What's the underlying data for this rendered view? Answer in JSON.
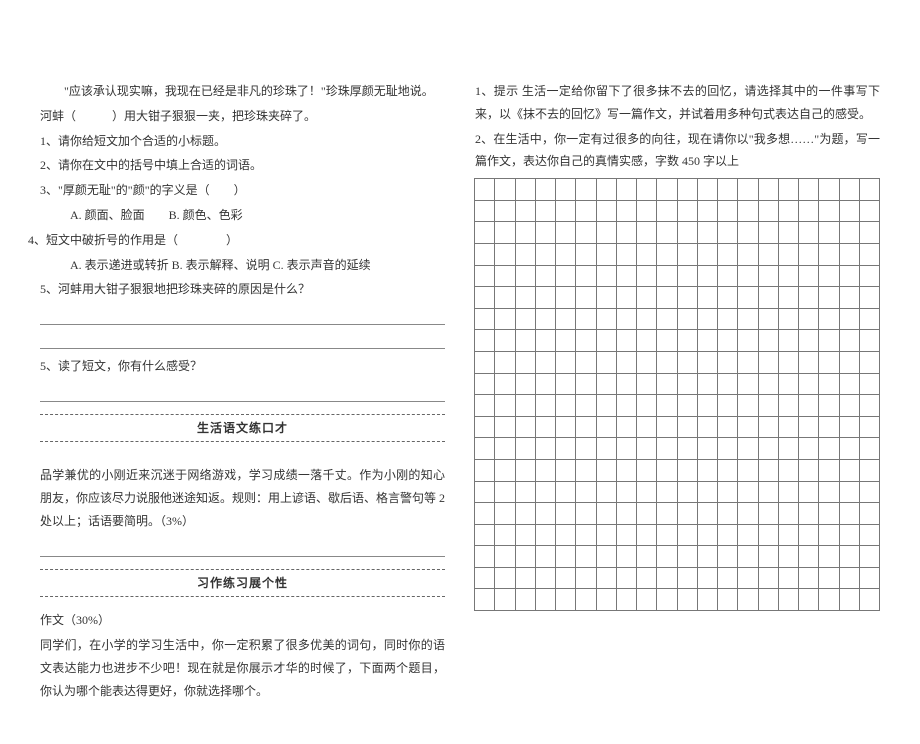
{
  "left": {
    "l1": "\"应该承认现实嘛，我现在已经是非凡的珍珠了！\"珍珠厚颜无耻地说。",
    "l2": "河蚌（　　　）用大钳子狠狠一夹，把珍珠夹碎了。",
    "q1": "1、请你给短文加个合适的小标题。",
    "q2": "2、请你在文中的括号中填上合适的词语。",
    "q3": "3、\"厚颜无耻\"的\"颜\"的字义是（　　）",
    "q3opts": "A. 颜面、脸面　　B. 颜色、色彩",
    "q4": "4、短文中破折号的作用是（　　　　）",
    "q4opts": "A. 表示递进或转折  B. 表示解释、说明  C. 表示声音的延续",
    "q5": "5、河蚌用大钳子狠狠地把珍珠夹碎的原因是什么？",
    "q6": "5、读了短文，你有什么感受？",
    "sec1": "生活语文练口才",
    "p1": "品学兼优的小刚近来沉迷于网络游戏，学习成绩一落千丈。作为小刚的知心朋友，你应该尽力说服他迷途知返。规则：用上谚语、歇后语、格言警句等 2 处以上；话语要简明。（3%）",
    "sec2": "习作练习展个性",
    "zw": "作文（30%）",
    "p2": "同学们，在小学的学习生活中，你一定积累了很多优美的词句，同时你的语文表达能力也进步不少吧！现在就是你展示才华的时候了，下面两个题目，你认为哪个能表达得更好，你就选择哪个。"
  },
  "right": {
    "r1": "1、提示  生活一定给你留下了很多抹不去的回忆，请选择其中的一件事写下来，以《抹不去的回忆》写一篇作文，并试着用多种句式表达自己的感受。",
    "r2": "2、在生活中，你一定有过很多的向往，现在请你以\"我多想……\"为题，写一篇作文，表达你自己的真情实感，字数 450 字以上"
  },
  "grid": {
    "rows": 20,
    "cols": 20
  }
}
